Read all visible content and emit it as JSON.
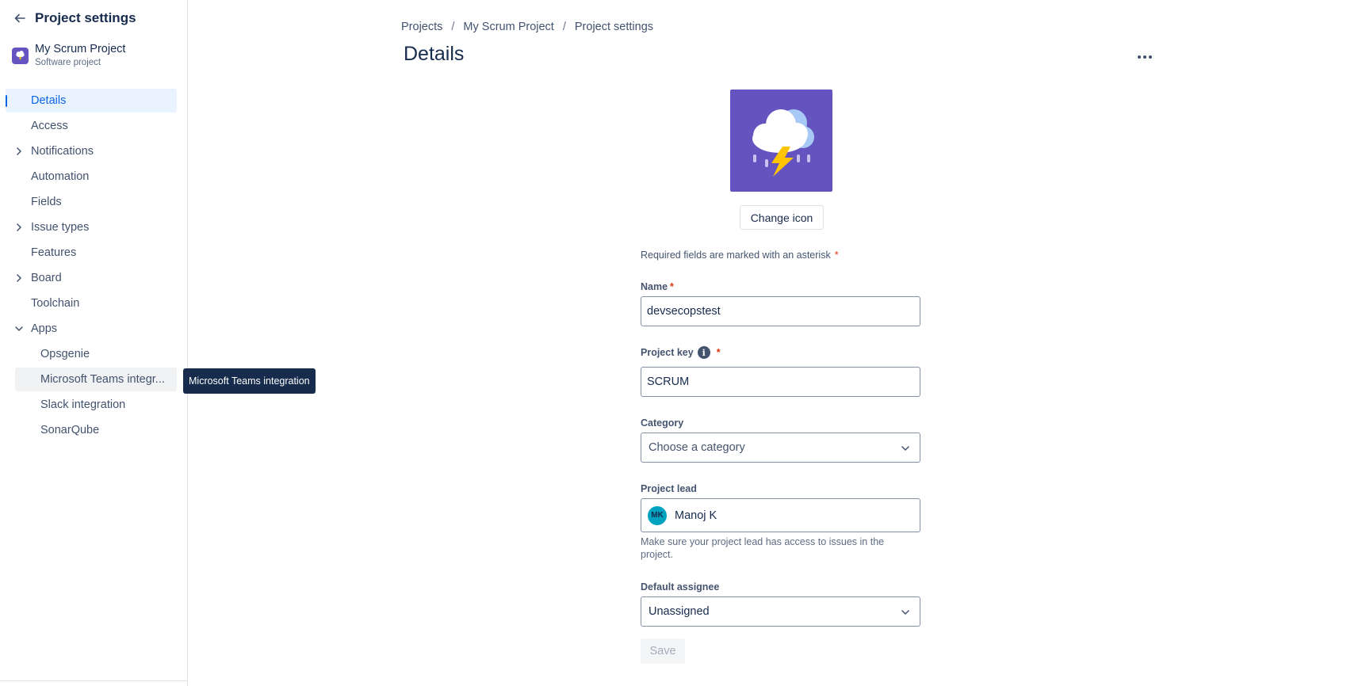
{
  "sidebar": {
    "title": "Project settings",
    "project": {
      "name": "My Scrum Project",
      "type": "Software project"
    },
    "items": [
      {
        "label": "Details"
      },
      {
        "label": "Access"
      },
      {
        "label": "Notifications"
      },
      {
        "label": "Automation"
      },
      {
        "label": "Fields"
      },
      {
        "label": "Issue types"
      },
      {
        "label": "Features"
      },
      {
        "label": "Board"
      },
      {
        "label": "Toolchain"
      },
      {
        "label": "Apps"
      }
    ],
    "apps": [
      {
        "label": "Opsgenie"
      },
      {
        "label": "Microsoft Teams integr..."
      },
      {
        "label": "Slack integration"
      },
      {
        "label": "SonarQube"
      }
    ],
    "tooltip": "Microsoft Teams integration"
  },
  "breadcrumb": {
    "items": [
      "Projects",
      "My Scrum Project",
      "Project settings"
    ],
    "separator": "/"
  },
  "page": {
    "title": "Details"
  },
  "form": {
    "change_icon_label": "Change icon",
    "required_note": "Required fields are marked with an asterisk",
    "asterisk": "*",
    "name": {
      "label": "Name",
      "value": "devsecopstest"
    },
    "project_key": {
      "label": "Project key",
      "value": "SCRUM"
    },
    "category": {
      "label": "Category",
      "placeholder": "Choose a category"
    },
    "project_lead": {
      "label": "Project lead",
      "initials": "MK",
      "name": "Manoj K",
      "helper": "Make sure your project lead has access to issues in the project."
    },
    "default_assignee": {
      "label": "Default assignee",
      "value": "Unassigned"
    },
    "save_label": "Save"
  },
  "colors": {
    "accent": "#0c66e4",
    "project_icon_bg": "#6554c0",
    "lead_avatar_bg": "#00a3bf",
    "required": "#de350b"
  }
}
